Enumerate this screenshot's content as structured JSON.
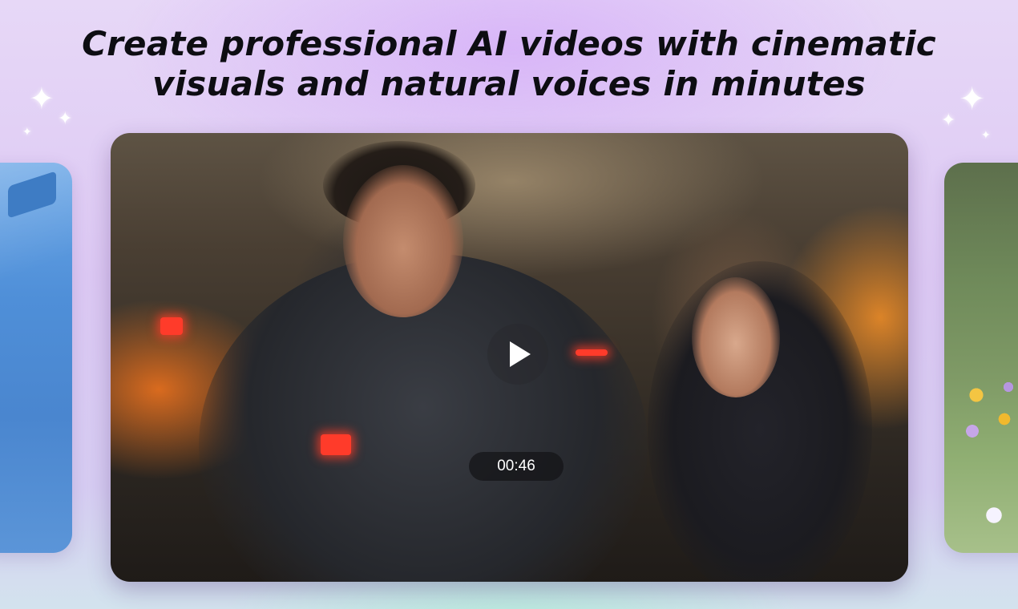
{
  "headline": {
    "line1": "Create professional AI videos with cinematic",
    "line2": "visuals and natural voices in minutes"
  },
  "video": {
    "duration": "00:46",
    "play_icon": "play-icon"
  },
  "carousel": {
    "items": 3,
    "active_index": 1
  },
  "colors": {
    "headline": "#0d0d12",
    "background_top": "#e7d8f7",
    "background_bottom": "#d3e3ee",
    "badge_bg": "#141416"
  },
  "decorations": {
    "sparkle_icon": "sparkle-icon"
  }
}
